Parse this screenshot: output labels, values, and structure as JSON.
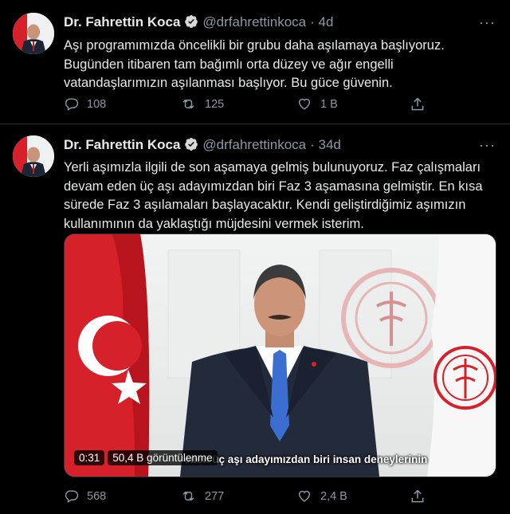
{
  "tweets": [
    {
      "author_name": "Dr. Fahrettin Koca",
      "handle": "@drfahrettinkoca",
      "time": "· 4d",
      "text": "Aşı programımızda öncelikli bir grubu daha aşılamaya başlıyoruz. Bugünden itibaren tam bağımlı orta düzey ve ağır engelli vatandaşlarımızın aşılanması başlıyor. Bu güce güvenin.",
      "replies": "108",
      "retweets": "125",
      "likes": "1 B"
    },
    {
      "author_name": "Dr. Fahrettin Koca",
      "handle": "@drfahrettinkoca",
      "time": "· 34d",
      "text": "Yerli aşımızla ilgili de son aşamaya gelmiş bulunuyoruz. Faz çalışmaları devam eden üç aşı adayımızdan biri Faz 3 aşamasına gelmiştir. En kısa sürede Faz 3 aşılamaları başlayacaktır. Kendi geliştirdiğimiz aşımızın kullanımının da yaklaştığı müjdesini vermek isterim.",
      "video": {
        "duration": "0:31",
        "views": "50,4 B görüntülenme",
        "subtitle": "eden üç aşı adayımızdan biri insan deneylerinin"
      },
      "replies": "568",
      "retweets": "277",
      "likes": "2,4 B"
    }
  ],
  "more_label": "···",
  "colors": {
    "background": "#000000",
    "text": "#e7e9ea",
    "secondary": "#8b98a5",
    "verified": "#d9d9d9",
    "flag_red": "#d6202a"
  }
}
